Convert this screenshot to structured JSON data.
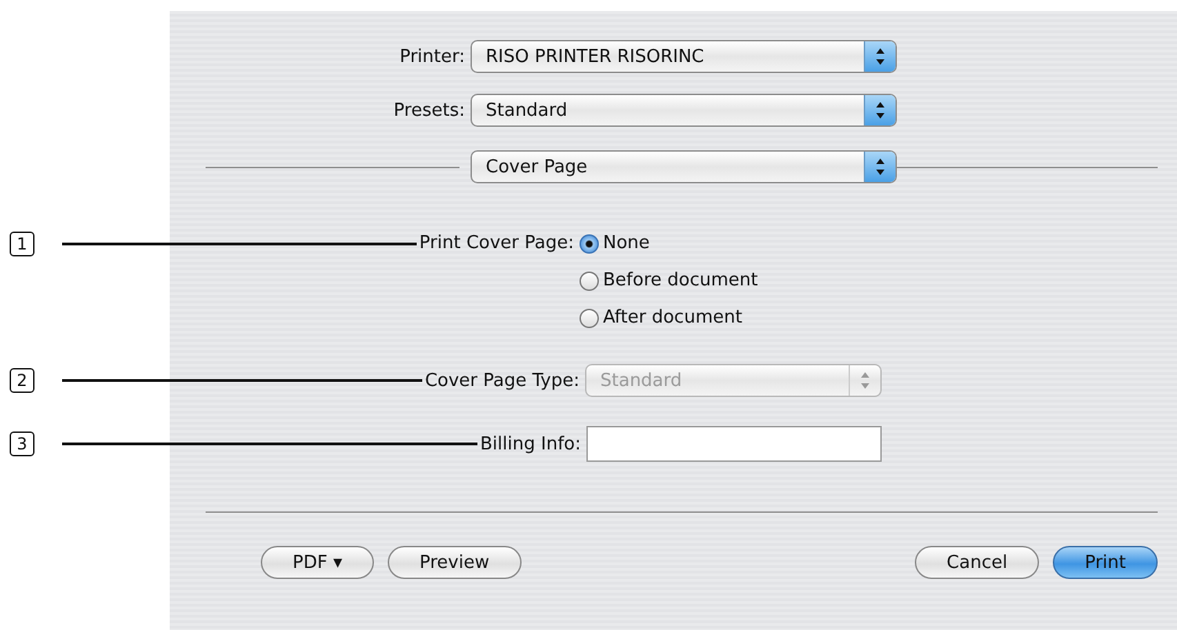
{
  "printer": {
    "label": "Printer:",
    "value": "RISO PRINTER RISORINC"
  },
  "presets": {
    "label": "Presets:",
    "value": "Standard"
  },
  "pane": {
    "value": "Cover Page"
  },
  "print_cover_page": {
    "callout": "1",
    "label": "Print Cover Page:",
    "options": [
      {
        "label": "None",
        "selected": true
      },
      {
        "label": "Before document",
        "selected": false
      },
      {
        "label": "After document",
        "selected": false
      }
    ]
  },
  "cover_page_type": {
    "callout": "2",
    "label": "Cover Page Type:",
    "value": "Standard",
    "disabled": true
  },
  "billing_info": {
    "callout": "3",
    "label": "Billing Info:"
  },
  "buttons": [
    {
      "label": "PDF ▾",
      "kind": "plain"
    },
    {
      "label": "Preview",
      "kind": "plain"
    },
    {
      "label": "Cancel",
      "kind": "plain"
    },
    {
      "label": "Print",
      "kind": "default"
    }
  ]
}
